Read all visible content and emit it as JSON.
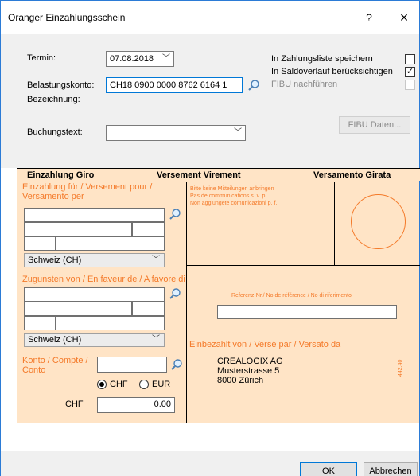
{
  "window": {
    "title": "Oranger Einzahlungsschein",
    "help_label": "?",
    "close_label": "×"
  },
  "form": {
    "termin_label": "Termin:",
    "termin_value": "07.08.2018",
    "belastungskonto_label": "Belastungskonto:",
    "belastungskonto_value": "CH18 0900 0000 8762 6164 1",
    "bezeichnung_label": "Bezeichnung:",
    "buchungstext_label": "Buchungstext:",
    "buchungstext_value": ""
  },
  "options": {
    "zahlungsliste_label": "In Zahlungsliste speichern",
    "zahlungsliste_checked": false,
    "saldoverlauf_label": "In Saldoverlauf berücksichtigen",
    "saldoverlauf_checked": true,
    "fibu_label": "FIBU nachführen",
    "fibu_checked": false,
    "fibu_button": "FIBU Daten..."
  },
  "slip": {
    "head_left": "Einzahlung Giro",
    "head_center": "Versement Virement",
    "head_right": "Versamento Girata",
    "einzahlung_fuer": "Einzahlung für / Versement pour / Versamento per",
    "notice_1": "Bitte keine Mitteilungen anbringen",
    "notice_2": "Pas de communications s. v. p.",
    "notice_3": "Non aggiungete comunicazioni p. f.",
    "country_1": "Schweiz (CH)",
    "zugunsten": "Zugunsten von / En faveur de / A favore di",
    "country_2": "Schweiz (CH)",
    "referenz": "Referenz-Nr./ No de référence / No di riferimento",
    "einbezahlt": "Einbezahlt von / Versé par / Versato da",
    "payer_line1": "CREALOGIX AG",
    "payer_line2": "Musterstrasse 5",
    "payer_line3": "8000 Zürich",
    "konto_label": "Konto / Compte / Conto",
    "currency_chf": "CHF",
    "currency_eur": "EUR",
    "currency_selected": "CHF",
    "amount_label": "CHF",
    "amount_value": "0.00",
    "side_code": "442.40"
  },
  "buttons": {
    "ok": "OK",
    "cancel": "Abbrechen"
  },
  "colors": {
    "slip_background": "#ffe4c6",
    "slip_text": "#f47a2a",
    "focus_border": "#0078d7"
  }
}
